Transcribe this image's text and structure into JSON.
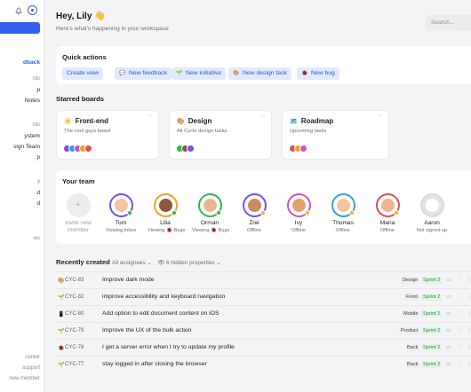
{
  "sidebar": {
    "items": [
      {
        "label": "dback",
        "active": true
      },
      {
        "label": "rds",
        "muted": true
      },
      {
        "label": "p",
        "muted": false
      },
      {
        "label": "Notes",
        "muted": false
      },
      {
        "label": "rds",
        "muted": true
      },
      {
        "label": "ystem",
        "muted": false
      },
      {
        "label": "sign Team",
        "muted": false
      },
      {
        "label": "p",
        "muted": false
      },
      {
        "label": "y",
        "muted": true
      },
      {
        "label": "d",
        "muted": false
      },
      {
        "label": "d",
        "muted": false
      },
      {
        "label": "ws",
        "muted": true
      },
      {
        "label": "center",
        "muted": true
      },
      {
        "label": "support",
        "muted": true
      },
      {
        "label": "new member",
        "muted": true
      }
    ]
  },
  "header": {
    "greeting": "Hey, Lily 👋",
    "subtitle": "Here's what's happening in your workspace",
    "search_placeholder": "Search..."
  },
  "quick_actions": {
    "title": "Quick actions",
    "buttons": [
      {
        "icon": "",
        "label": "Create view"
      },
      {
        "icon": "💬",
        "label": "New feedback"
      },
      {
        "icon": "🌱",
        "label": "New initiative"
      },
      {
        "icon": "🎨",
        "label": "New design task"
      },
      {
        "icon": "🐞",
        "label": "New bug"
      }
    ]
  },
  "starred": {
    "title": "Starred boards",
    "boards": [
      {
        "emoji": "☀️",
        "name": "Front-end",
        "desc": "The cool guys board",
        "more": "···"
      },
      {
        "emoji": "🎨",
        "name": "Design",
        "desc": "All Cycle design tasks",
        "more": "···"
      },
      {
        "emoji": "🗺️",
        "name": "Roadmap",
        "desc": "Upcoming tasks",
        "more": "···"
      }
    ]
  },
  "team": {
    "title": "Your team",
    "members": [
      {
        "name": "Invite new member",
        "status": "",
        "invite": true
      },
      {
        "name": "Tom",
        "status": "Viewing Inbox",
        "ring": "#7a4df0",
        "face": "#f2c6a0",
        "dot": "#31b650"
      },
      {
        "name": "Lilia",
        "status": "Viewing 🐞 Bugs",
        "ring": "#f0a11d",
        "face": "#8a5a3b",
        "dot": "#31b650"
      },
      {
        "name": "Orman",
        "status": "Viewing 🐞 Bugs",
        "ring": "#31b650",
        "face": "#e5b891",
        "dot": "#31b650"
      },
      {
        "name": "Zoé",
        "status": "Offline",
        "ring": "#7a4df0",
        "face": "#c98b5f",
        "dot": "#f0b41d"
      },
      {
        "name": "Ivy",
        "status": "Offline",
        "ring": "#d64fc4",
        "face": "#e3a26c",
        "dot": "#f0b41d"
      },
      {
        "name": "Thomas",
        "status": "Offline",
        "ring": "#2aa7d8",
        "face": "#f2c6a0",
        "dot": "#f0b41d"
      },
      {
        "name": "Maria",
        "status": "Offline",
        "ring": "#e34b5b",
        "face": "#f2b38f",
        "dot": "#f0b41d"
      },
      {
        "name": "Aaron",
        "status": "Not signed up",
        "ring": "#c9c9cf",
        "face": "#e4e4e7",
        "dot": ""
      }
    ]
  },
  "recent": {
    "title": "Recently created",
    "filter_assignees": "All assignees",
    "filter_hidden": "👁 6 hidden properties",
    "issues": [
      {
        "icon": "🎨",
        "id": "CYC-83",
        "title": "Improve dark mode",
        "label": "Design",
        "sprint": "Sprint 2"
      },
      {
        "icon": "🌱",
        "id": "CYC-82",
        "title": "improve accessibility and keyboard navigation",
        "label": "Front",
        "sprint": "Sprint 2"
      },
      {
        "icon": "📱",
        "id": "CYC-80",
        "title": "Add option to edit document content on iOS",
        "label": "Mobile",
        "sprint": "Sprint 2"
      },
      {
        "icon": "🌱",
        "id": "CYC-79",
        "title": "Improve the UX of the bulk action",
        "label": "Product",
        "sprint": "Sprint 2"
      },
      {
        "icon": "🐞",
        "id": "CYC-78",
        "title": "I get a server error when I try to update my profile",
        "label": "Back",
        "sprint": "Sprint 2"
      },
      {
        "icon": "🌱",
        "id": "CYC-77",
        "title": "stay logged in after closing the browser",
        "label": "Back",
        "sprint": "Sprint 2"
      }
    ]
  }
}
